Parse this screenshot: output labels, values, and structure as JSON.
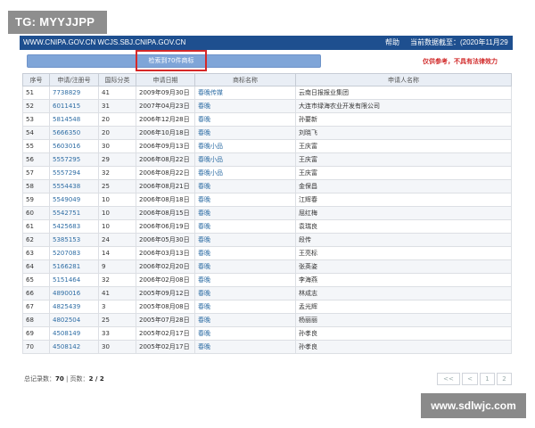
{
  "watermark_top": "TG: MYYJJPP",
  "watermark_bottom": "www.sdlwjc.com",
  "header": {
    "urls": "WWW.CNIPA.GOV.CN WCJS.SBJ.CNIPA.GOV.CN",
    "help": "帮助",
    "date": "当前数据截至：(2020年11月29日)"
  },
  "search_result_label": "检索到70件商标",
  "disclaimer": "仅供参考，不具有法律效力",
  "table": {
    "headers": [
      "序号",
      "申请/注册号",
      "国际分类",
      "申请日期",
      "商标名称",
      "申请人名称"
    ],
    "rows": [
      [
        "51",
        "7738829",
        "41",
        "2009年09月30日",
        "春晚传媒",
        "云南日报报业集团"
      ],
      [
        "52",
        "6011415",
        "31",
        "2007年04月23日",
        "春晚",
        "大连市绿海农业开发有限公司"
      ],
      [
        "53",
        "5814548",
        "20",
        "2006年12月28日",
        "春晚",
        "孙要新"
      ],
      [
        "54",
        "5666350",
        "20",
        "2006年10月18日",
        "春晚",
        "刘晓飞"
      ],
      [
        "55",
        "5603016",
        "30",
        "2006年09月13日",
        "春晚小品",
        "王庆富"
      ],
      [
        "56",
        "5557295",
        "29",
        "2006年08月22日",
        "春晚小品",
        "王庆富"
      ],
      [
        "57",
        "5557294",
        "32",
        "2006年08月22日",
        "春晚小品",
        "王庆富"
      ],
      [
        "58",
        "5554438",
        "25",
        "2006年08月21日",
        "春晚",
        "金保昌"
      ],
      [
        "59",
        "5549049",
        "10",
        "2006年08月18日",
        "春晚",
        "江辉春"
      ],
      [
        "60",
        "5542751",
        "10",
        "2006年08月15日",
        "春晚",
        "屈红梅"
      ],
      [
        "61",
        "5425683",
        "10",
        "2006年06月19日",
        "春晚",
        "袁瑞良"
      ],
      [
        "62",
        "5385153",
        "24",
        "2006年05月30日",
        "春晚",
        "段传"
      ],
      [
        "63",
        "5207083",
        "14",
        "2006年03月13日",
        "春晚",
        "王亮标"
      ],
      [
        "64",
        "5166281",
        "9",
        "2006年02月20日",
        "春晚",
        "张英姿"
      ],
      [
        "65",
        "5151464",
        "32",
        "2006年02月08日",
        "春晚",
        "李海燕"
      ],
      [
        "66",
        "4890016",
        "41",
        "2005年09月12日",
        "春晚",
        "林成志"
      ],
      [
        "67",
        "4825439",
        "3",
        "2005年08月08日",
        "春晚",
        "孟光辉"
      ],
      [
        "68",
        "4802504",
        "25",
        "2005年07月28日",
        "春晚",
        "杨丽丽"
      ],
      [
        "69",
        "4508149",
        "33",
        "2005年02月17日",
        "春晚",
        "孙孝良"
      ],
      [
        "70",
        "4508142",
        "30",
        "2005年02月17日",
        "春晚",
        "孙孝良"
      ]
    ]
  },
  "footer": {
    "total_label": "总记录数：",
    "total_value": "70",
    "pages_label": " | 页数：",
    "pages_value": "2 / 2"
  },
  "pager": [
    "<<",
    "<",
    "1",
    "2"
  ]
}
